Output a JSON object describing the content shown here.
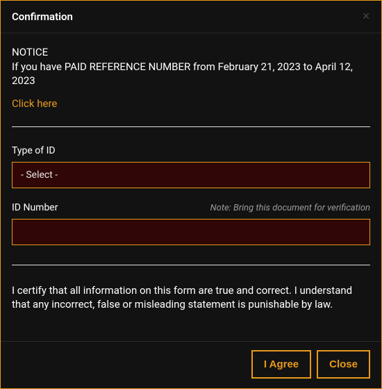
{
  "header": {
    "title": "Confirmation"
  },
  "notice": {
    "title": "NOTICE",
    "text": "If you have PAID REFERENCE NUMBER from February 21, 2023 to April 12, 2023",
    "link": "Click here"
  },
  "form": {
    "type_of_id_label": "Type of ID",
    "type_of_id_selected": "- Select -",
    "id_number_label": "ID Number",
    "id_number_note": "Note: Bring this document for verification",
    "id_number_value": ""
  },
  "certification": "I certify that all information on this form are true and correct. I understand that any incorrect, false or misleading statement is punishable by law.",
  "buttons": {
    "agree": "I Agree",
    "close": "Close"
  }
}
